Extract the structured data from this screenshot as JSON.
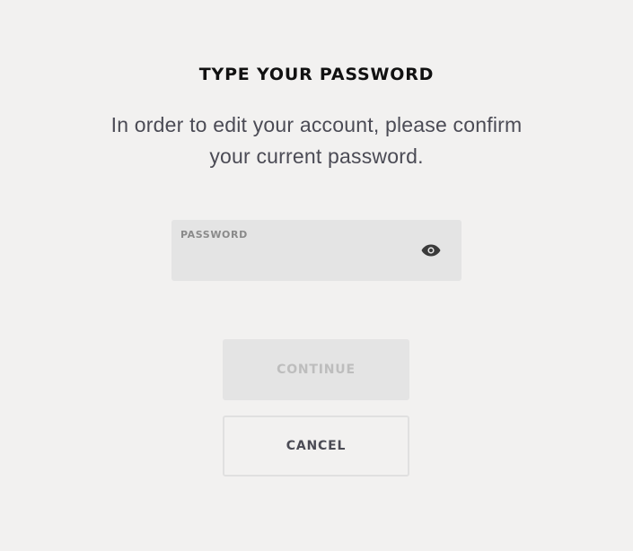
{
  "dialog": {
    "title": "TYPE YOUR PASSWORD",
    "message": "In order to edit your account, please confirm your current password."
  },
  "password_field": {
    "label": "PASSWORD",
    "value": "",
    "toggle_icon": "eye-icon"
  },
  "buttons": {
    "continue_label": "CONTINUE",
    "continue_enabled": false,
    "cancel_label": "CANCEL"
  },
  "colors": {
    "background": "#f2f1f0",
    "field_background": "#e4e4e4",
    "title_text": "#111111",
    "body_text": "#4b4b55",
    "disabled_text": "#bdbdbd"
  }
}
